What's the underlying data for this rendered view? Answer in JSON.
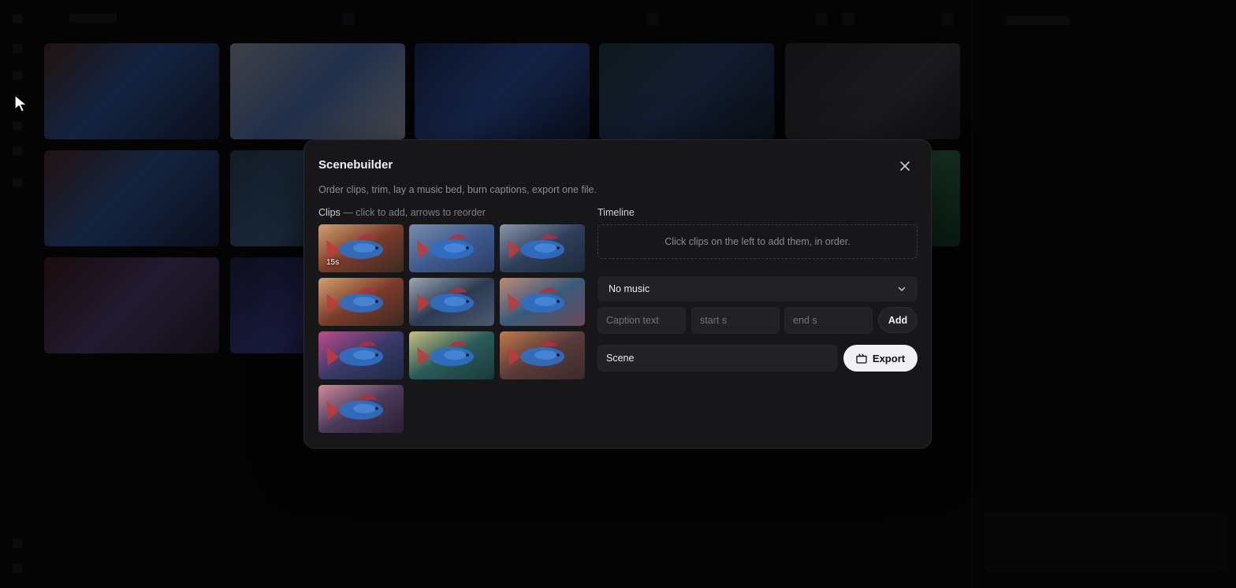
{
  "modal": {
    "title": "Scenebuilder",
    "subtitle": "Order clips, trim, lay a music bed, burn captions, export one file.",
    "clips_label": "Clips",
    "clips_hint": " — click to add, arrows to reorder",
    "timeline_label": "Timeline",
    "timeline_empty": "Click clips on the left to add them, in order.",
    "music": {
      "selected": "No music"
    },
    "caption": {
      "text_placeholder": "Caption text",
      "start_placeholder": "start s",
      "end_placeholder": "end s",
      "add_label": "Add"
    },
    "scene_name": "Scene",
    "export_label": "Export",
    "clips": [
      {
        "duration": "15s",
        "scene": "betta fish with red fins, warm bokeh"
      },
      {
        "duration": "",
        "scene": "blue betta fish close-up"
      },
      {
        "duration": "",
        "scene": "betta fish in steel structure"
      },
      {
        "duration": "",
        "scene": "betta fish with red fins, warm bokeh"
      },
      {
        "duration": "",
        "scene": "betta fish in steel tower"
      },
      {
        "duration": "",
        "scene": "betta fish over city skyline at dusk"
      },
      {
        "duration": "",
        "scene": "betta fish in neon city street"
      },
      {
        "duration": "",
        "scene": "betta fish underwater light rays"
      },
      {
        "duration": "",
        "scene": "betta fish in busy city"
      },
      {
        "duration": "",
        "scene": "betta fish in neon rainy street"
      }
    ]
  },
  "colors": {
    "modal_bg": "#17171a",
    "field_bg": "#222226",
    "export_bg": "#f1f1f3",
    "fish_blue": "#2f6fc4",
    "fin_red": "#c23a3a"
  }
}
